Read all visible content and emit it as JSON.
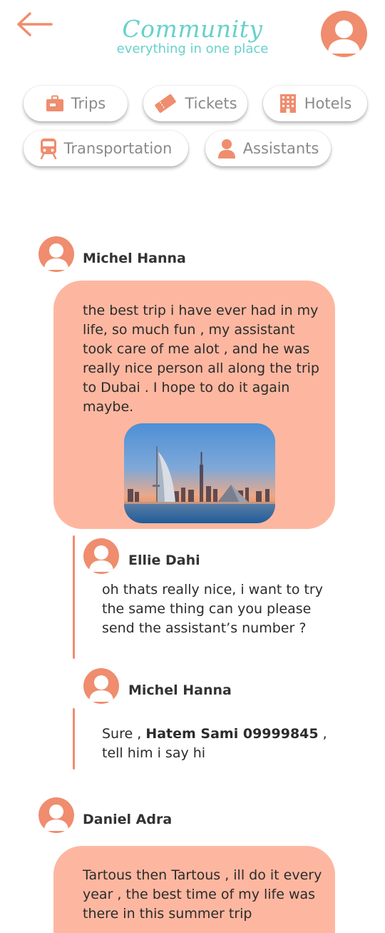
{
  "header": {
    "title": "Community",
    "subtitle": "everything in one place"
  },
  "categories": [
    {
      "label": "Trips",
      "icon": "suitcase-icon"
    },
    {
      "label": "Tickets",
      "icon": "ticket-icon"
    },
    {
      "label": "Hotels",
      "icon": "hotel-icon"
    },
    {
      "label": "Transportation",
      "icon": "train-icon"
    },
    {
      "label": "Assistants",
      "icon": "person-icon"
    }
  ],
  "posts": [
    {
      "author": "Michel Hanna",
      "text": "the best trip i have ever had in my life, so much fun , my assistant took care of me alot , and he was really nice person all along the trip to Dubai . I hope to do it again maybe.",
      "replies": [
        {
          "author": "Ellie Dahi",
          "text": "oh thats really nice,  i want to try the same thing can you please send the assistant’s number ?"
        },
        {
          "author": "Michel Hanna",
          "text_before": "Sure , ",
          "text_bold": "Hatem Sami 09999845",
          "text_after": " , tell him i say hi"
        }
      ]
    },
    {
      "author": "Daniel Adra",
      "text": "Tartous then Tartous , ill do it every year , the best time of my life was there in this summer trip"
    }
  ],
  "colors": {
    "accent": "#ef8d6e",
    "teal": "#67d1cc",
    "bubble": "#fdb7a0"
  }
}
